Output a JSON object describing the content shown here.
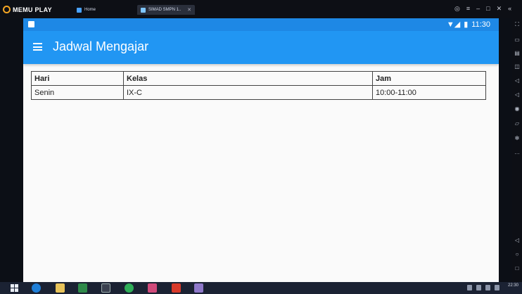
{
  "emulator": {
    "brand": "MEMU PLAY",
    "tabs": [
      {
        "label": "Home"
      },
      {
        "label": "SIMAD SMPN 1.."
      }
    ]
  },
  "status_bar": {
    "time": "11:30"
  },
  "app_bar": {
    "title": "Jadwal Mengajar"
  },
  "schedule_table": {
    "headers": [
      "Hari",
      "Kelas",
      "Jam"
    ],
    "rows": [
      [
        "Senin",
        "IX-C",
        "10:00-11:00"
      ]
    ]
  },
  "taskbar": {
    "clock": "22:30"
  },
  "colors": {
    "app_bar": "#2196f3",
    "status_bar": "#1e88e5"
  }
}
